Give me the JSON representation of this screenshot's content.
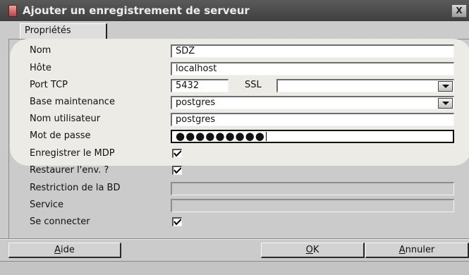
{
  "window": {
    "title": "Ajouter un enregistrement de serveur",
    "close_label": "X"
  },
  "tabs": [
    {
      "label": "Propriétés"
    }
  ],
  "form": {
    "nom": {
      "label": "Nom",
      "value": "SDZ"
    },
    "hote": {
      "label": "Hôte",
      "value": "localhost"
    },
    "port": {
      "label": "Port TCP",
      "value": "5432"
    },
    "ssl": {
      "label": "SSL",
      "value": ""
    },
    "base_maintenance": {
      "label": "Base maintenance",
      "value": "postgres"
    },
    "nom_utilisateur": {
      "label": "Nom utilisateur",
      "value": "postgres"
    },
    "mot_de_passe": {
      "label": "Mot de passe",
      "value": "●●●●●●●●●"
    },
    "enregistrer_mdp": {
      "label": "Enregistrer le MDP",
      "checked": true
    },
    "restaurer_env": {
      "label": "Restaurer l'env. ?",
      "checked": true
    },
    "restriction_bd": {
      "label": "Restriction de la BD",
      "value": ""
    },
    "service": {
      "label": "Service",
      "value": ""
    },
    "se_connecter": {
      "label": "Se connecter",
      "checked": true
    }
  },
  "buttons": {
    "aide": {
      "mnemonic": "A",
      "rest": "ide"
    },
    "ok": {
      "mnemonic": "O",
      "rest": "K"
    },
    "annuler": {
      "mnemonic": "A",
      "rest": "nnuler"
    }
  },
  "colors": {
    "dialog_background": "#cbcbcb",
    "titlebar": "#4a4a4a",
    "highlight_overlay": "#ecebe5"
  },
  "icons": {
    "window_icon": "pgadmin-server-icon",
    "close": "close-icon",
    "dropdown": "chevron-down-icon",
    "checkbox": "checkmark-icon"
  }
}
